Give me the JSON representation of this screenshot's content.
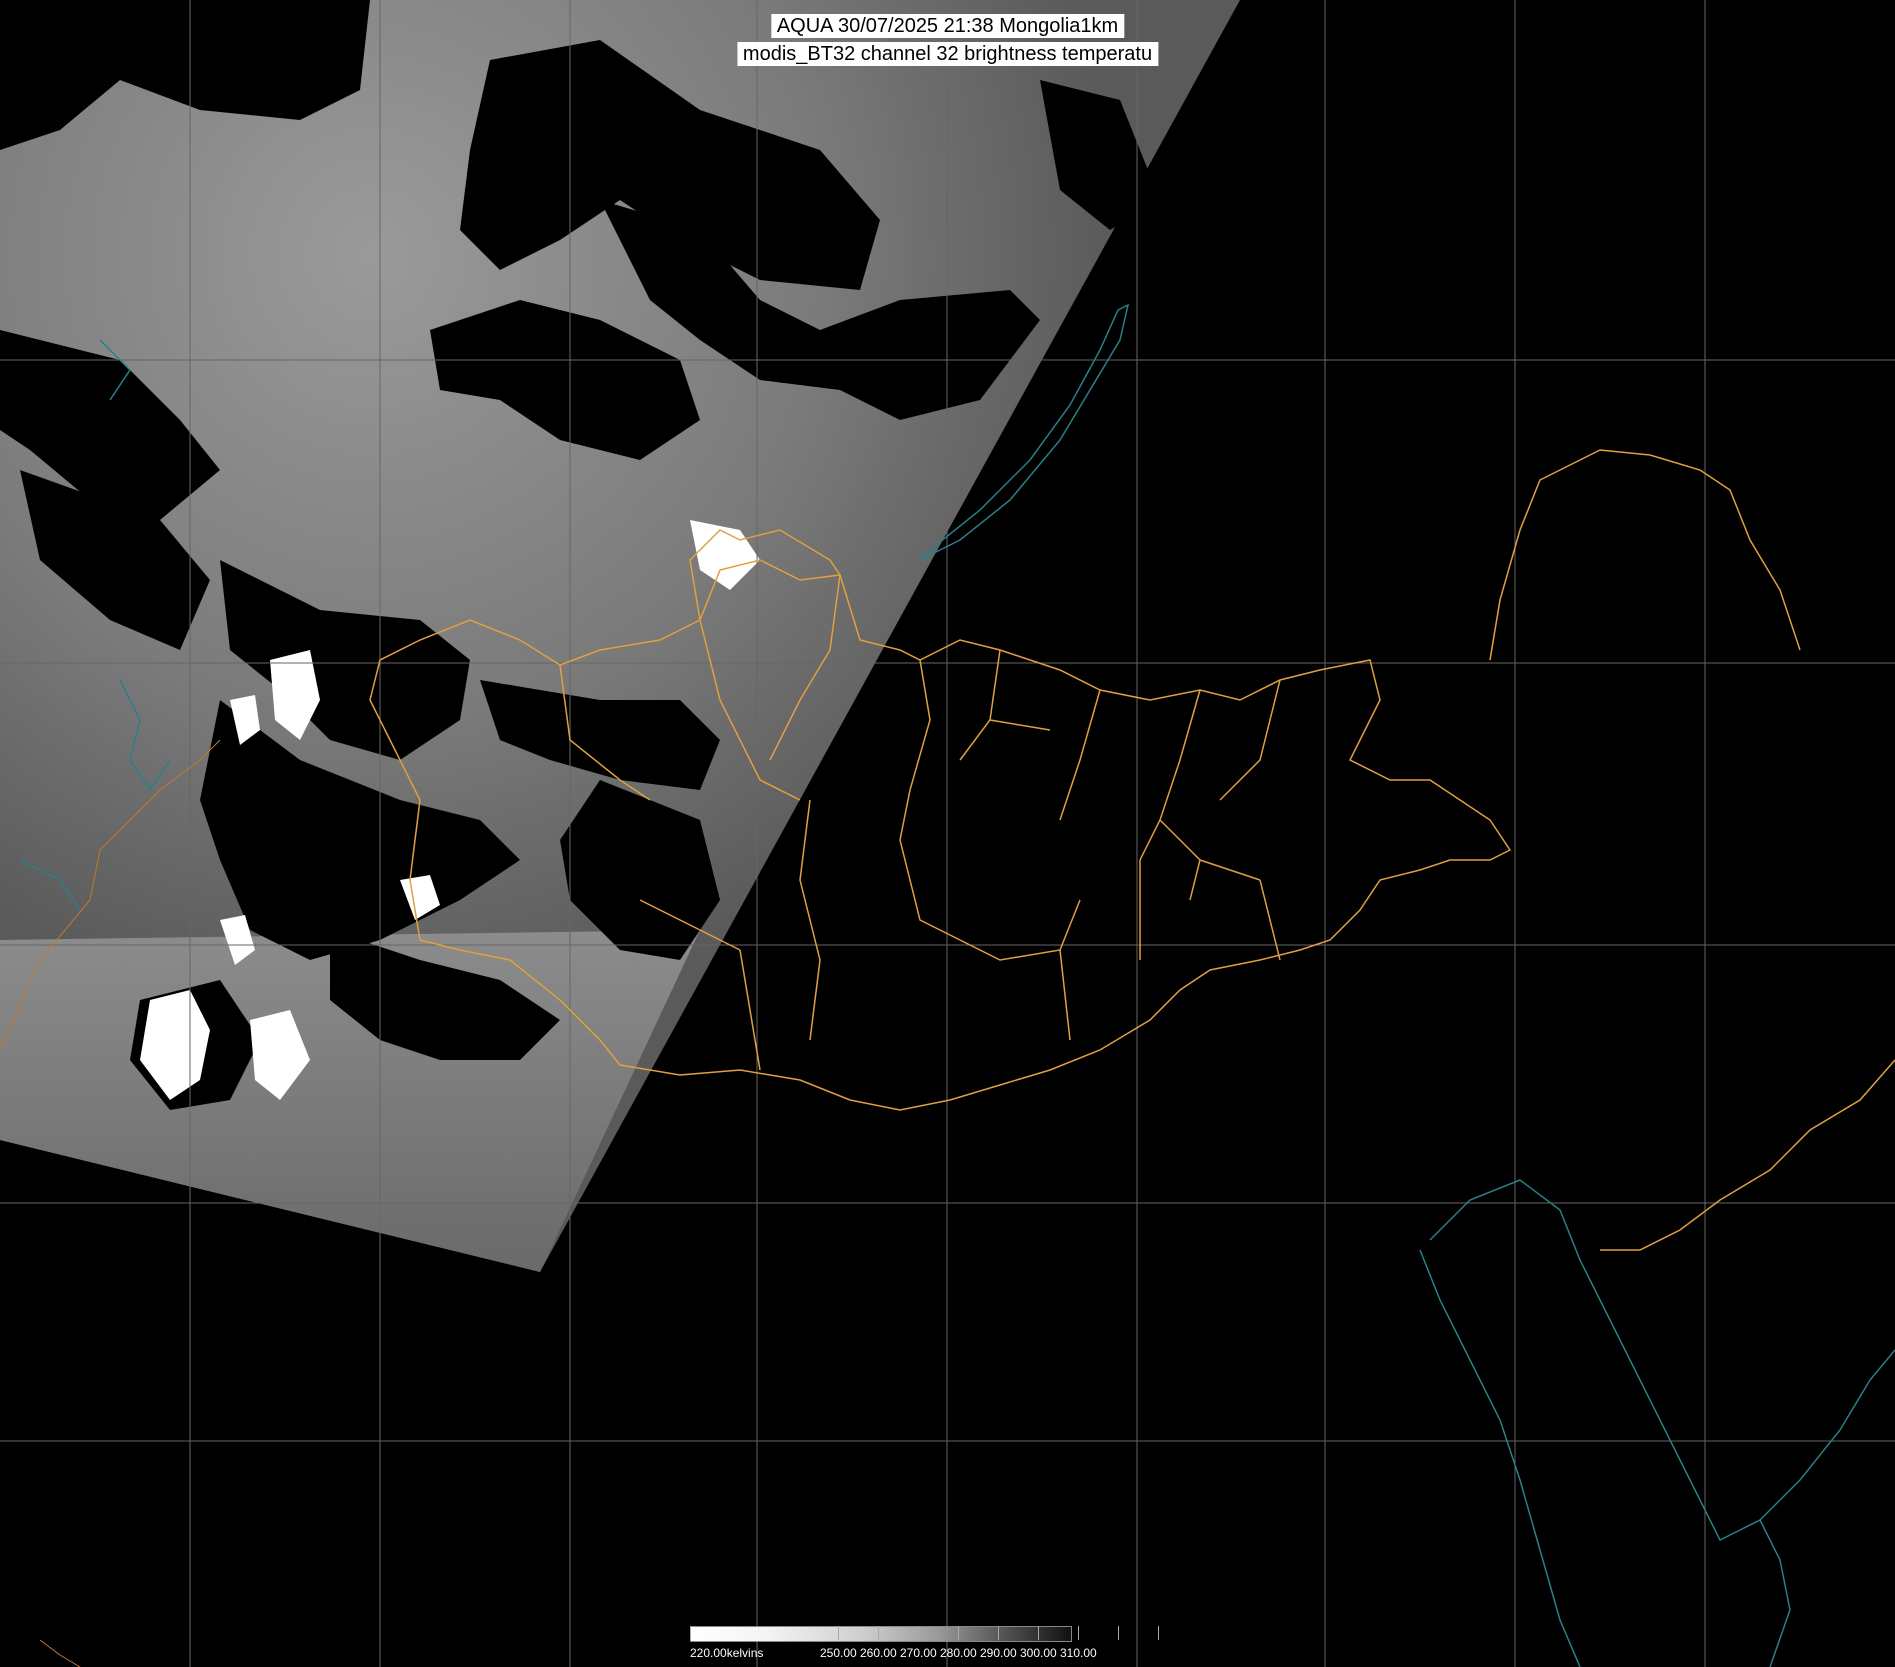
{
  "title": {
    "line1": "AQUA 30/07/2025 21:38 Mongolia1km",
    "line2": "modis_BT32 channel 32 brightness temperatu"
  },
  "colorbar": {
    "unit_label": "220.00kelvins",
    "ticks": [
      "250.00",
      "260.00",
      "270.00",
      "280.00",
      "290.00",
      "300.00",
      "310.00"
    ]
  },
  "colors": {
    "background": "#000000",
    "graticule": "#666666",
    "admin_boundaries": "#e0a040",
    "coastlines_water": "#2a7f8a",
    "title_box": "#ffffff"
  },
  "layers": {
    "satellite_swath": "modis_BT32 brightness temperature (grayscale)",
    "graticule": "on",
    "admin_boundaries": "on",
    "coastlines": "on"
  }
}
